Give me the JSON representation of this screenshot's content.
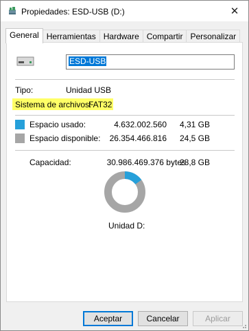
{
  "window": {
    "title": "Propiedades: ESD-USB (D:)"
  },
  "tabs": [
    {
      "label": "General"
    },
    {
      "label": "Herramientas"
    },
    {
      "label": "Hardware"
    },
    {
      "label": "Compartir"
    },
    {
      "label": "Personalizar"
    }
  ],
  "general": {
    "volume_name": "ESD-USB",
    "type_label": "Tipo:",
    "type_value": "Unidad USB",
    "fs_label": "Sistema de archivos:",
    "fs_value": "FAT32",
    "used_label": "Espacio usado:",
    "used_bytes": "4.632.002.560",
    "used_size": "4,31 GB",
    "free_label": "Espacio disponible:",
    "free_bytes": "26.354.466.816",
    "free_size": "24,5 GB",
    "capacity_label": "Capacidad:",
    "capacity_bytes": "30.986.469.376 bytes",
    "capacity_size": "28,8 GB",
    "drive_label": "Unidad D:",
    "used_fraction": 0.1495
  },
  "buttons": {
    "ok": "Aceptar",
    "cancel": "Cancelar",
    "apply": "Aplicar"
  },
  "colors": {
    "used": "#26a0da",
    "free": "#a6a6a6",
    "highlight": "#ffff66"
  }
}
